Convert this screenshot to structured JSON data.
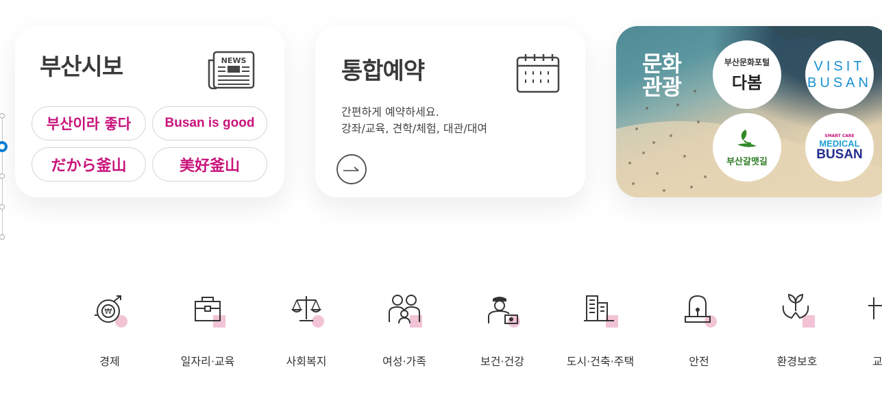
{
  "news_card": {
    "title": "부산시보",
    "icon_label": "NEWS",
    "pills": [
      "부산이라 좋다",
      "Busan is good",
      "だから釜山",
      "美好釜山"
    ]
  },
  "booking_card": {
    "title": "통합예약",
    "desc_line1": "간편하게 예약하세요.",
    "desc_line2": "강좌/교육, 견학/체험, 대관/대여"
  },
  "culture_card": {
    "title_line1": "문화",
    "title_line2": "관광",
    "dabom_small": "부산문화포털",
    "dabom_big": "다봄",
    "visit_line1": "VISIT",
    "visit_line2": "BUSAN",
    "galmaet": "부산갈맷길",
    "medical_small": "SMART CARE",
    "medical_line1": "MEDICAL",
    "medical_line2": "BUSAN"
  },
  "categories": [
    "경제",
    "일자리·교육",
    "사회복지",
    "여성·가족",
    "보건·건강",
    "도시·건축·주택",
    "안전",
    "환경보호",
    "교"
  ],
  "colors": {
    "accent_pink": "#c8127b",
    "slider_blue": "#0b7fd8",
    "icon_pink": "#f1c3d5"
  }
}
